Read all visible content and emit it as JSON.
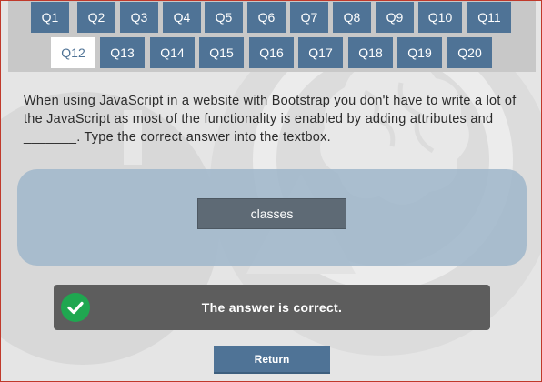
{
  "nav": {
    "row1": [
      "Q1",
      "Q2",
      "Q3",
      "Q4",
      "Q5",
      "Q6",
      "Q7",
      "Q8",
      "Q9",
      "Q10",
      "Q11"
    ],
    "row2": [
      "Q12",
      "Q13",
      "Q14",
      "Q15",
      "Q16",
      "Q17",
      "Q18",
      "Q19",
      "Q20"
    ],
    "active": "Q12"
  },
  "question": {
    "text": "When using JavaScript in a website with Bootstrap you don't have to write a lot of the JavaScript as most of the functionality is enabled by adding attributes and _______. Type the correct answer into the textbox."
  },
  "answer": {
    "value": "classes"
  },
  "feedback": {
    "text": "The answer is correct.",
    "status": "correct",
    "icon": "checkmark-icon"
  },
  "return_button": {
    "label": "Return"
  },
  "colors": {
    "accent": "#4f7396",
    "success": "#1fa750",
    "frame": "#c0392b"
  }
}
